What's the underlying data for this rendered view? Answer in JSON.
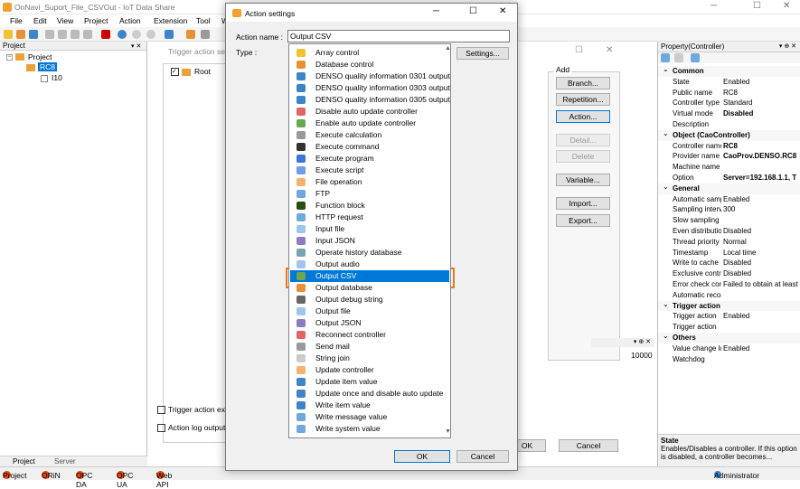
{
  "app": {
    "title": "OnNavi_Suport_File_CSVOut - IoT Data Share",
    "menu": [
      "File",
      "Edit",
      "View",
      "Project",
      "Action",
      "Extension",
      "Tool",
      "W"
    ]
  },
  "project_panel": {
    "header": "Project",
    "tree": {
      "root": "Project",
      "controller": "RC8",
      "child": "I10"
    },
    "tabs": {
      "project": "Project",
      "server": "Server"
    }
  },
  "trigger_panel": {
    "tab_title": "Trigger action setti",
    "root_label": "Root",
    "checkbox1": "Trigger action exe",
    "checkbox2": "Action log output",
    "value_10000": "10000",
    "ok_label": "OK",
    "cancel_label": "Cancel"
  },
  "add_panel": {
    "title": "Add",
    "buttons": [
      "Branch...",
      "Repetition...",
      "Action...",
      "Detail...",
      "Delete",
      "Variable...",
      "Import...",
      "Export..."
    ]
  },
  "dialog": {
    "title": "Action settings",
    "name_label": "Action name :",
    "name_value": "Output CSV",
    "type_label": "Type :",
    "settings_button": "Settings...",
    "ok_button": "OK",
    "cancel_button": "Cancel",
    "selected_index": 19,
    "types": [
      {
        "label": "Array control",
        "icon": "array-icon",
        "color": "#f1c232"
      },
      {
        "label": "Database control",
        "icon": "database-icon",
        "color": "#e69138"
      },
      {
        "label": "DENSO quality information 0301 output",
        "icon": "gear-icon",
        "color": "#3d85c6"
      },
      {
        "label": "DENSO quality information 0303 output",
        "icon": "gear-icon",
        "color": "#3d85c6"
      },
      {
        "label": "DENSO quality information 0305 output",
        "icon": "gear-icon",
        "color": "#3d85c6"
      },
      {
        "label": "Disable auto update controller",
        "icon": "disable-icon",
        "color": "#e06666"
      },
      {
        "label": "Enable auto update controller",
        "icon": "refresh-icon",
        "color": "#6aa84f"
      },
      {
        "label": "Execute calculation",
        "icon": "calculator-icon",
        "color": "#999999"
      },
      {
        "label": "Execute command",
        "icon": "command-icon",
        "color": "#333333"
      },
      {
        "label": "Execute program",
        "icon": "program-icon",
        "color": "#3c78d8"
      },
      {
        "label": "Execute script",
        "icon": "script-icon",
        "color": "#6d9eeb"
      },
      {
        "label": "File operation",
        "icon": "file-operation-icon",
        "color": "#f6b26b"
      },
      {
        "label": "FTP",
        "icon": "globe-icon",
        "color": "#6fa8dc"
      },
      {
        "label": "Function block",
        "icon": "function-block-icon",
        "color": "#274e13"
      },
      {
        "label": "HTTP request",
        "icon": "globe-icon",
        "color": "#6fa8dc"
      },
      {
        "label": "Input file",
        "icon": "input-file-icon",
        "color": "#9fc5e8"
      },
      {
        "label": "Input JSON",
        "icon": "json-icon",
        "color": "#8e7cc3"
      },
      {
        "label": "Operate history database",
        "icon": "table-icon",
        "color": "#76a5af"
      },
      {
        "label": "Output audio",
        "icon": "speaker-icon",
        "color": "#a4c2f4"
      },
      {
        "label": "Output CSV",
        "icon": "csv-icon",
        "color": "#6aa84f"
      },
      {
        "label": "Output database",
        "icon": "database-icon",
        "color": "#e69138"
      },
      {
        "label": "Output debug string",
        "icon": "debug-icon",
        "color": "#666666"
      },
      {
        "label": "Output file",
        "icon": "output-file-icon",
        "color": "#9fc5e8"
      },
      {
        "label": "Output JSON",
        "icon": "json-icon",
        "color": "#8e7cc3"
      },
      {
        "label": "Reconnect controller",
        "icon": "reconnect-icon",
        "color": "#e06666"
      },
      {
        "label": "Send mail",
        "icon": "mail-icon",
        "color": "#999999"
      },
      {
        "label": "String join",
        "icon": "string-join-icon",
        "color": "#cccccc"
      },
      {
        "label": "Update controller",
        "icon": "update-controller-icon",
        "color": "#f6b26b"
      },
      {
        "label": "Update item value",
        "icon": "update-item-icon",
        "color": "#3d85c6"
      },
      {
        "label": "Update once and disable auto update",
        "icon": "info-icon",
        "color": "#3d85c6"
      },
      {
        "label": "Write item value",
        "icon": "write-icon",
        "color": "#3d85c6"
      },
      {
        "label": "Write message value",
        "icon": "message-icon",
        "color": "#6fa8dc"
      },
      {
        "label": "Write system value",
        "icon": "system-icon",
        "color": "#6fa8dc"
      }
    ]
  },
  "properties": {
    "header": "Property(Controller)",
    "rows": [
      {
        "cat": true,
        "k": "Common"
      },
      {
        "k": "State",
        "v": "Enabled"
      },
      {
        "k": "Public name",
        "v": "RC8"
      },
      {
        "k": "Controller type",
        "v": "Standard"
      },
      {
        "k": "Virtual mode",
        "v": "Disabled",
        "bold": true
      },
      {
        "k": "Description",
        "v": ""
      },
      {
        "cat": true,
        "k": "Object (CaoController)"
      },
      {
        "k": "Controller name",
        "v": "RC8",
        "bold": true
      },
      {
        "k": "Provider name",
        "v": "CaoProv.DENSO.RC8",
        "bold": true
      },
      {
        "k": "Machine name",
        "v": ""
      },
      {
        "k": "Option",
        "v": "Server=192.168.1.1, T",
        "bold": true
      },
      {
        "cat": true,
        "k": "General"
      },
      {
        "k": "Automatic sampling",
        "v": "Enabled"
      },
      {
        "k": "Sampling interval",
        "v": "300"
      },
      {
        "k": "Slow sampling",
        "v": ""
      },
      {
        "k": "Even distribution",
        "v": "Disabled"
      },
      {
        "k": "Thread priority",
        "v": "Normal"
      },
      {
        "k": "Timestamp",
        "v": "Local time"
      },
      {
        "k": "Write to cache",
        "v": "Disabled"
      },
      {
        "k": "Exclusive control",
        "v": "Disabled"
      },
      {
        "k": "Error check con",
        "v": "Failed to obtain at least"
      },
      {
        "k": "Automatic reconnect",
        "v": ""
      },
      {
        "cat": true,
        "k": "Trigger action"
      },
      {
        "k": "Trigger action",
        "v": "Enabled"
      },
      {
        "k": "Trigger action",
        "v": ""
      },
      {
        "cat": true,
        "k": "Others"
      },
      {
        "k": "Value change log",
        "v": "Enabled"
      },
      {
        "k": "Watchdog",
        "v": ""
      }
    ],
    "desc_title": "State",
    "desc_text": "Enables/Disables a controller. If this option is disabled, a controller becomes..."
  },
  "status": {
    "items": [
      "Project",
      "ORiN",
      "OPC DA",
      "OPC UA",
      "Web API"
    ],
    "user": "Administrator"
  }
}
